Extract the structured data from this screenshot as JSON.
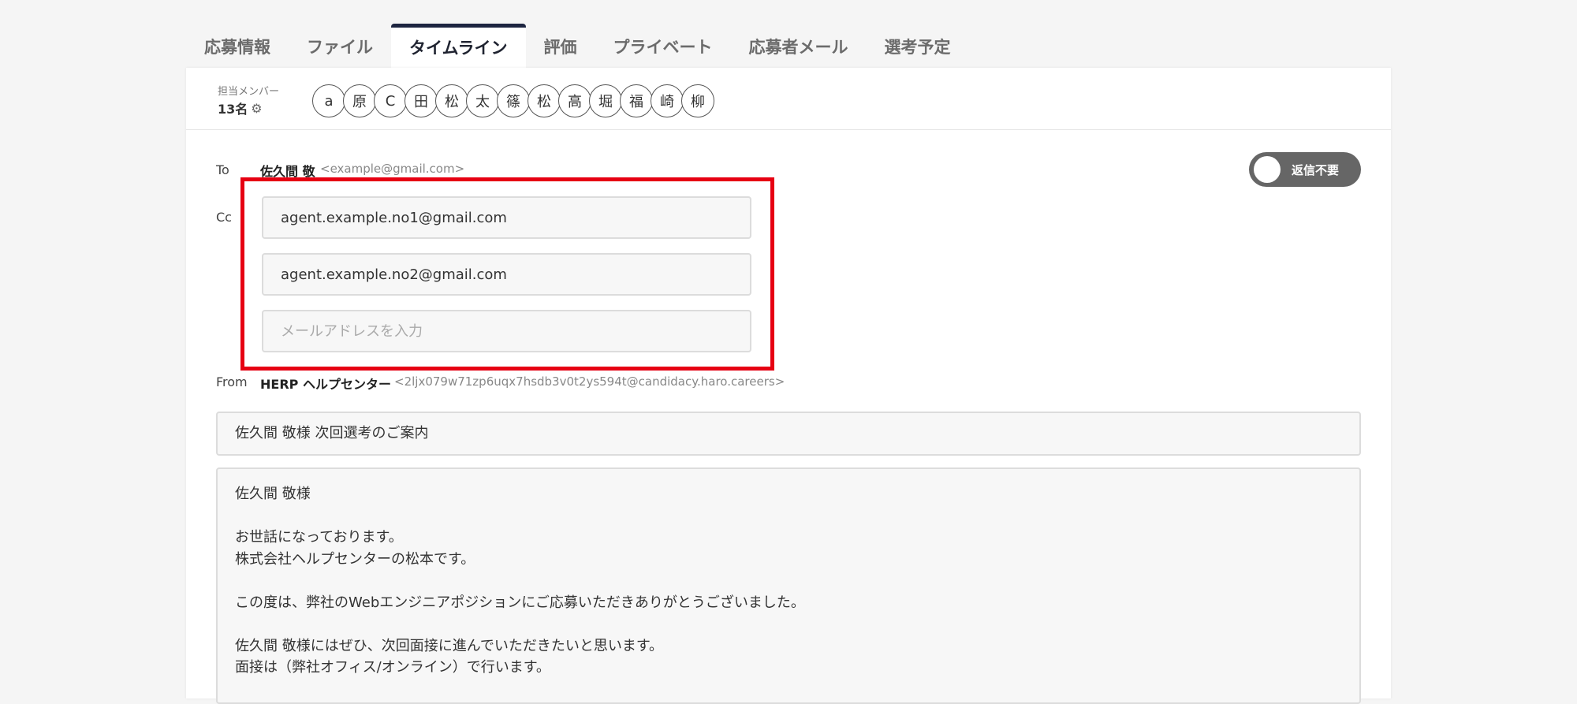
{
  "tabs": [
    {
      "label": "応募情報",
      "active": false
    },
    {
      "label": "ファイル",
      "active": false
    },
    {
      "label": "タイムライン",
      "active": true
    },
    {
      "label": "評価",
      "active": false
    },
    {
      "label": "プライベート",
      "active": false
    },
    {
      "label": "応募者メール",
      "active": false
    },
    {
      "label": "選考予定",
      "active": false
    }
  ],
  "members": {
    "label": "担当メンバー",
    "count": "13名",
    "avatars": [
      "a",
      "原",
      "C",
      "田",
      "松",
      "太",
      "篠",
      "松",
      "高",
      "堀",
      "福",
      "崎",
      "柳"
    ]
  },
  "email": {
    "to_label": "To",
    "to_name": "佐久間 敬",
    "to_email": "<example@gmail.com>",
    "no_reply_toggle_label": "返信不要",
    "cc_label": "Cc",
    "cc": [
      "agent.example.no1@gmail.com",
      "agent.example.no2@gmail.com"
    ],
    "cc_placeholder": "メールアドレスを入力",
    "from_label": "From",
    "from_name": "HERP ヘルプセンター",
    "from_email": "<2ljx079w71zp6uqx7hsdb3v0t2ys594t@candidacy.haro.careers>",
    "subject": "佐久間 敬様 次回選考のご案内",
    "body_lines": [
      "佐久間 敬様",
      "",
      "お世話になっております。",
      "株式会社ヘルプセンターの松本です。",
      "",
      "この度は、弊社のWebエンジニアポジションにご応募いただきありがとうございました。",
      "",
      "佐久間 敬様にはぜひ、次回面接に進んでいただきたいと思います。",
      "面接は（弊社オフィス/オンライン）で行います。"
    ]
  },
  "colors": {
    "highlight": "#e60012",
    "active_tab_border": "#1d2540",
    "toggle_bg": "#666666"
  }
}
